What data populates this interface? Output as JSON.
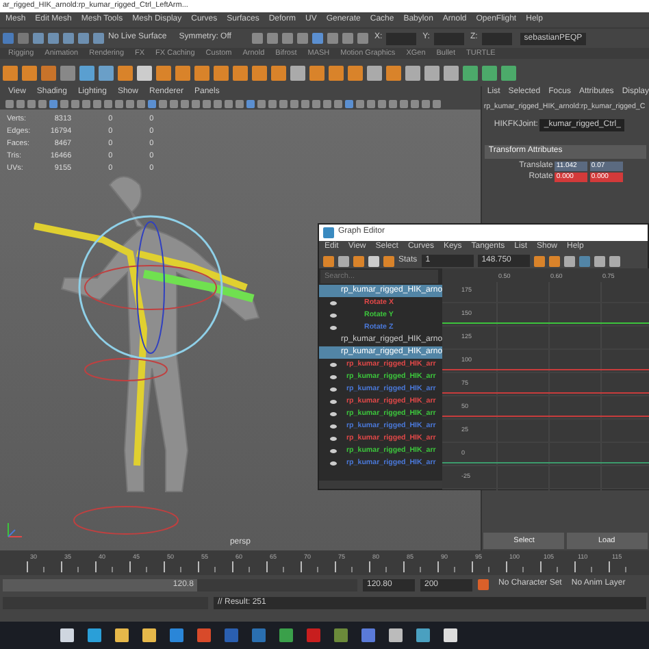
{
  "window": {
    "title": "ar_rigged_HIK_arnold:rp_kumar_rigged_Ctrl_LeftArm..."
  },
  "menu": [
    "Mesh",
    "Edit Mesh",
    "Mesh Tools",
    "Mesh Display",
    "Curves",
    "Surfaces",
    "Deform",
    "UV",
    "Generate",
    "Cache",
    "Babylon",
    "Arnold",
    "OpenFlight",
    "Help"
  ],
  "status_line": {
    "live_surface": "No Live Surface",
    "symmetry": "Symmetry: Off",
    "coord_labels": [
      "X:",
      "Y:",
      "Z:"
    ],
    "user": "sebastianPEQP"
  },
  "shelf_tabs": [
    {
      "label": "Rigging",
      "selected": false
    },
    {
      "label": "Animation",
      "selected": false
    },
    {
      "label": "Rendering",
      "selected": false
    },
    {
      "label": "FX",
      "selected": false
    },
    {
      "label": "FX Caching",
      "selected": false
    },
    {
      "label": "Custom",
      "selected": false
    },
    {
      "label": "Arnold",
      "selected": false
    },
    {
      "label": "Bifrost",
      "selected": false
    },
    {
      "label": "MASH",
      "selected": false
    },
    {
      "label": "Motion Graphics",
      "selected": false
    },
    {
      "label": "XGen",
      "selected": false
    },
    {
      "label": "Bullet",
      "selected": false
    },
    {
      "label": "TURTLE",
      "selected": false
    }
  ],
  "viewport": {
    "menu": [
      "View",
      "Shading",
      "Lighting",
      "Show",
      "Renderer",
      "Panels"
    ],
    "stats": [
      {
        "label": "Verts:",
        "values": [
          "8313",
          "0",
          "0"
        ]
      },
      {
        "label": "Edges:",
        "values": [
          "16794",
          "0",
          "0"
        ]
      },
      {
        "label": "Faces:",
        "values": [
          "8467",
          "0",
          "0"
        ]
      },
      {
        "label": "Tris:",
        "values": [
          "16466",
          "0",
          "0"
        ]
      },
      {
        "label": "UVs:",
        "values": [
          "9155",
          "0",
          "0"
        ]
      }
    ],
    "camera": "persp"
  },
  "attribute_editor": {
    "tabs": [
      "List",
      "Selected",
      "Focus",
      "Attributes",
      "Display"
    ],
    "node": "rp_kumar_rigged_HIK_arnold:rp_kumar_rigged_C",
    "type_label": "HIKFKJoint:",
    "type_value": "_kumar_rigged_Ctrl_",
    "section": "Transform Attributes",
    "rows": [
      {
        "label": "Translate",
        "values": [
          {
            "text": "11.042",
            "keyed": false
          },
          {
            "text": "0.07",
            "keyed": false
          }
        ]
      },
      {
        "label": "Rotate",
        "values": [
          {
            "text": "0.000",
            "keyed": true
          },
          {
            "text": "0.000",
            "keyed": true
          }
        ]
      }
    ],
    "buttons": [
      "Select",
      "Load"
    ]
  },
  "graph_editor": {
    "title": "Graph Editor",
    "menu": [
      "Edit",
      "View",
      "Select",
      "Curves",
      "Keys",
      "Tangents",
      "List",
      "Show",
      "Help"
    ],
    "stats_label": "Stats",
    "stats_values": [
      "1",
      "148.750"
    ],
    "search": {
      "placeholder": "Search..."
    },
    "outliner": [
      {
        "label": "rp_kumar_rigged_HIK_arno",
        "selected": true,
        "children": [
          {
            "label": "Rotate X",
            "color": "#e04848"
          },
          {
            "label": "Rotate Y",
            "color": "#3cc43c"
          },
          {
            "label": "Rotate Z",
            "color": "#4a78d8"
          }
        ]
      },
      {
        "label": "rp_kumar_rigged_HIK_arno",
        "selected": false
      },
      {
        "label": "rp_kumar_rigged_HIK_arno",
        "selected": true,
        "children": [
          {
            "label": "rp_kumar_rigged_HIK_arr",
            "color": "#e04848"
          },
          {
            "label": "rp_kumar_rigged_HIK_arr",
            "color": "#3cc43c"
          },
          {
            "label": "rp_kumar_rigged_HIK_arr",
            "color": "#4a78d8"
          },
          {
            "label": "rp_kumar_rigged_HIK_arr",
            "color": "#e04848"
          },
          {
            "label": "rp_kumar_rigged_HIK_arr",
            "color": "#3cc43c"
          },
          {
            "label": "rp_kumar_rigged_HIK_arr",
            "color": "#4a78d8"
          },
          {
            "label": "rp_kumar_rigged_HIK_arr",
            "color": "#e04848"
          },
          {
            "label": "rp_kumar_rigged_HIK_arr",
            "color": "#3cc43c"
          },
          {
            "label": "rp_kumar_rigged_HIK_arr",
            "color": "#4a78d8"
          }
        ]
      }
    ],
    "x_labels": [
      "0.50",
      "0.60",
      "0.75"
    ],
    "y_labels": [
      "175",
      "150",
      "125",
      "100",
      "75",
      "50",
      "25",
      "0",
      "-25"
    ]
  },
  "timeline": {
    "ticks": [
      "30",
      "35",
      "40",
      "45",
      "50",
      "55",
      "60",
      "65",
      "70",
      "75",
      "80",
      "85",
      "90",
      "95",
      "100",
      "105",
      "110",
      "115"
    ]
  },
  "range": {
    "level": 0.55,
    "slider_value": "120.8",
    "current": "120.80",
    "end": "200",
    "character_set": "No Character Set",
    "anim_layer": "No Anim Layer"
  },
  "command_line": {
    "result": "// Result: 251"
  }
}
